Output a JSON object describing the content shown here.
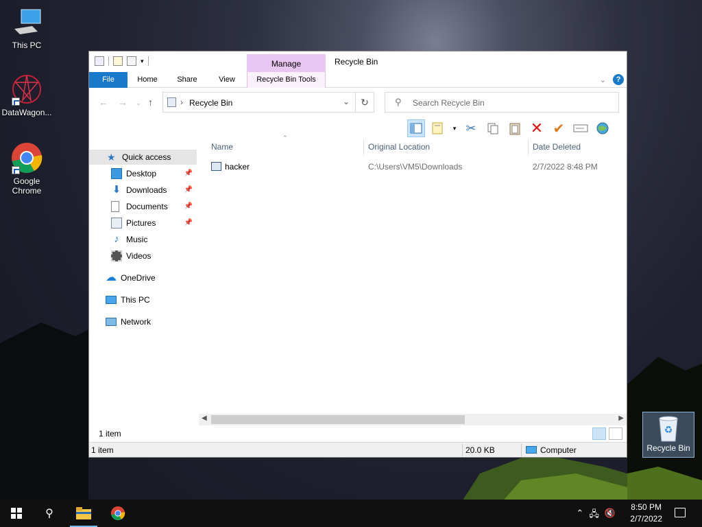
{
  "desktop": {
    "icons": [
      {
        "label": "This PC",
        "icon": "computer-icon"
      },
      {
        "label": "DataWagon...",
        "icon": "datawagon-app-icon"
      },
      {
        "label": "Google\nChrome",
        "label_line1": "Google",
        "label_line2": "Chrome",
        "icon": "chrome-icon"
      },
      {
        "label": "Recycle Bin",
        "icon": "recycle-bin-icon"
      }
    ]
  },
  "window": {
    "title": "Recycle Bin",
    "contextual_group": "Manage",
    "tabs": {
      "file": "File",
      "home": "Home",
      "share": "Share",
      "view": "View",
      "tools": "Recycle Bin Tools"
    },
    "help": "?",
    "address": {
      "path": "Recycle Bin",
      "separator": "›"
    },
    "search_placeholder": "Search Recycle Bin",
    "nav": {
      "quick_access": "Quick access",
      "items": [
        "Desktop",
        "Downloads",
        "Documents",
        "Pictures",
        "Music",
        "Videos"
      ],
      "onedrive": "OneDrive",
      "this_pc": "This PC",
      "network": "Network"
    },
    "columns": {
      "name": "Name",
      "original_location": "Original Location",
      "date_deleted": "Date Deleted"
    },
    "rows": [
      {
        "name": "hacker",
        "original_location": "C:\\Users\\VM5\\Downloads",
        "date_deleted": "2/7/2022 8:48 PM"
      }
    ],
    "item_count": "1 item",
    "status": {
      "items": "1 item",
      "size": "20.0 KB",
      "location": "Computer"
    }
  },
  "taskbar": {
    "time": "8:50 PM",
    "date": "2/7/2022"
  },
  "colors": {
    "accent": "#1979ca",
    "manage_tab": "#e9c6f2",
    "taskbar": "#101010"
  }
}
